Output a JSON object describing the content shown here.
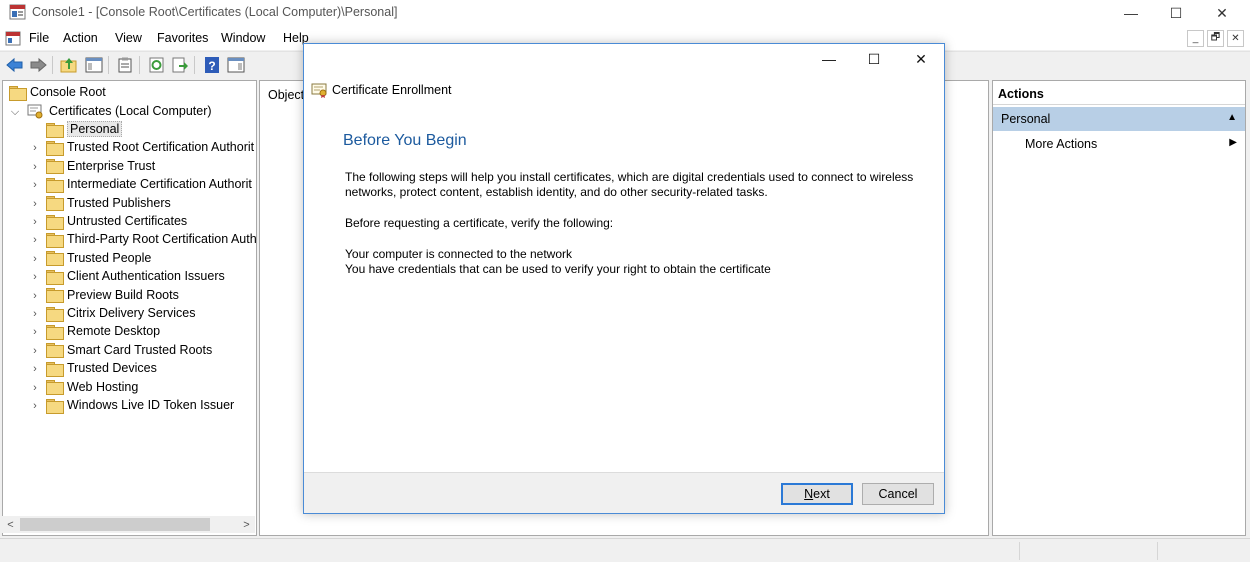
{
  "window": {
    "title": "Console1 - [Console Root\\Certificates (Local Computer)\\Personal]",
    "minimize_glyph": "—",
    "maximize_glyph": "☐",
    "close_glyph": "✕"
  },
  "menu": [
    "File",
    "Action",
    "View",
    "Favorites",
    "Window",
    "Help"
  ],
  "mdi_controls": [
    "_",
    "🗗",
    "✕"
  ],
  "toolbar": {
    "icons": [
      "back-icon",
      "forward-icon",
      "up-folder-icon",
      "show-hide-tree-icon",
      "properties-icon",
      "refresh-icon",
      "export-list-icon",
      "help-icon",
      "show-hide-action-pane-icon"
    ]
  },
  "tree": {
    "root": "Console Root",
    "certificates": "Certificates (Local Computer)",
    "items": [
      "Personal",
      "Trusted Root Certification Authorit",
      "Enterprise Trust",
      "Intermediate Certification Authorit",
      "Trusted Publishers",
      "Untrusted Certificates",
      "Third-Party Root Certification Auth",
      "Trusted People",
      "Client Authentication Issuers",
      "Preview Build Roots",
      "Citrix Delivery Services",
      "Remote Desktop",
      "Smart Card Trusted Roots",
      "Trusted Devices",
      "Web Hosting",
      "Windows Live ID Token Issuer"
    ],
    "selected_index": 0
  },
  "center": {
    "column_header": "Object"
  },
  "actions": {
    "header": "Actions",
    "section": "Personal",
    "more_actions": "More Actions"
  },
  "dialog": {
    "title": "Certificate Enrollment",
    "heading": "Before You Begin",
    "para1_line1": "The following steps will help you install certificates, which are digital credentials used to connect to wireless",
    "para1_line2": "networks, protect content, establish identity, and do other security-related tasks.",
    "para2": "Before requesting a certificate, verify the following:",
    "bullet1": "Your computer is connected to the network",
    "bullet2": "You have credentials that can be used to verify your right to obtain the certificate",
    "next_label_underlined": "N",
    "next_label_rest": "ext",
    "cancel_label": "Cancel"
  },
  "colors": {
    "heading_blue": "#1c5a9e",
    "dialog_border": "#4a8bd6",
    "section_bg": "#b8cfe6",
    "folder_yellow": "#f6d981"
  }
}
